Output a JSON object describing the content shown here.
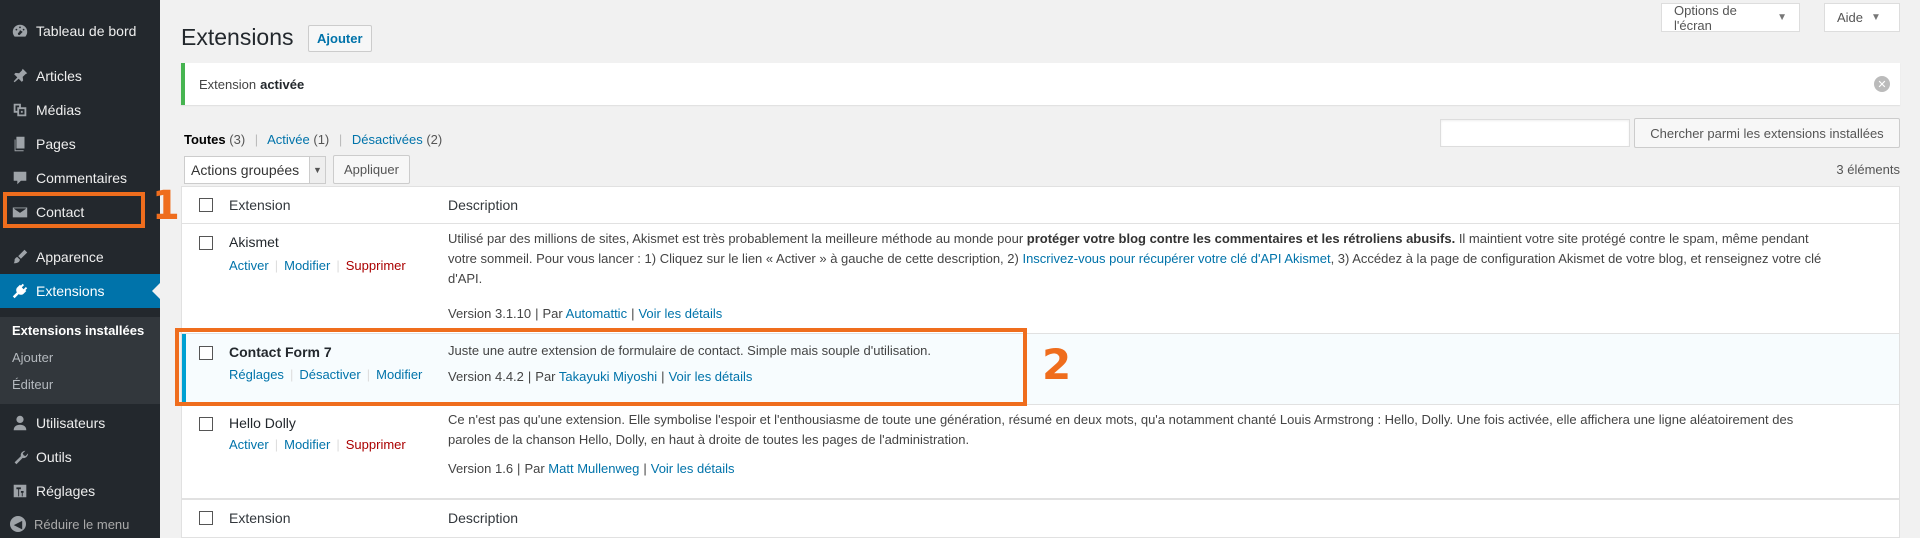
{
  "sidebar": {
    "items": [
      {
        "label": "Tableau de bord",
        "icon": "dashboard-icon"
      },
      {
        "label": "Articles",
        "icon": "pin-icon"
      },
      {
        "label": "Médias",
        "icon": "media-icon"
      },
      {
        "label": "Pages",
        "icon": "page-icon"
      },
      {
        "label": "Commentaires",
        "icon": "comment-icon"
      },
      {
        "label": "Contact",
        "icon": "envelope-icon"
      },
      {
        "label": "Apparence",
        "icon": "brush-icon"
      },
      {
        "label": "Extensions",
        "icon": "plugin-icon"
      },
      {
        "label": "Utilisateurs",
        "icon": "user-icon"
      },
      {
        "label": "Outils",
        "icon": "wrench-icon"
      },
      {
        "label": "Réglages",
        "icon": "sliders-icon"
      }
    ],
    "submenu": [
      "Extensions installées",
      "Ajouter",
      "Éditeur"
    ],
    "collapse_label": "Réduire le menu"
  },
  "annotations": {
    "one": "1",
    "two": "2"
  },
  "header": {
    "screen_options": "Options de l'écran",
    "help": "Aide",
    "title": "Extensions",
    "add_new": "Ajouter"
  },
  "notice": {
    "prefix": "Extension",
    "strong": "activée"
  },
  "filters": {
    "all": "Toutes",
    "all_count": "(3)",
    "active": "Activée",
    "active_count": "(1)",
    "inactive": "Désactivées",
    "inactive_count": "(2)"
  },
  "search": {
    "button": "Chercher parmi les extensions installées",
    "value": ""
  },
  "bulk": {
    "selected": "Actions groupées",
    "apply": "Appliquer"
  },
  "item_count": "3 éléments",
  "table": {
    "col_extension": "Extension",
    "col_description": "Description",
    "plugins": [
      {
        "name": "Akismet",
        "actions": [
          "Activer",
          "Modifier",
          "Supprimer"
        ],
        "desc_line1_a": "Utilisé par des millions de sites, Akismet est très probablement la meilleure méthode au monde pour ",
        "desc_line1_strong": "protéger votre blog contre les commentaires et les rétroliens abusifs.",
        "desc_line1_b": " Il maintient votre site protégé contre le spam, même pendant",
        "desc_line2_a": "votre sommeil. Pour vous lancer : 1) Cliquez sur le lien « Activer » à gauche de cette description, 2) ",
        "desc_line2_link": "Inscrivez-vous pour récupérer votre clé d'API Akismet",
        "desc_line2_b": ", 3) Accédez à la page de configuration Akismet de votre blog, et renseignez votre clé",
        "desc_line3": "d'API.",
        "version": "Version 3.1.10",
        "by": "Par",
        "author": "Automattic",
        "details": "Voir les détails"
      },
      {
        "name": "Contact Form 7",
        "actions": [
          "Réglages",
          "Désactiver",
          "Modifier"
        ],
        "desc": "Juste une autre extension de formulaire de contact. Simple mais souple d'utilisation.",
        "version": "Version 4.4.2",
        "by": "Par",
        "author": "Takayuki Miyoshi",
        "details": "Voir les détails"
      },
      {
        "name": "Hello Dolly",
        "actions": [
          "Activer",
          "Modifier",
          "Supprimer"
        ],
        "desc_line1": "Ce n'est pas qu'une extension. Elle symbolise l'espoir et l'enthousiasme de toute une génération, résumé en deux mots, qu'a notamment chanté Louis Armstrong : Hello, Dolly. Une fois activée, elle affichera une ligne aléatoirement des",
        "desc_line2": "paroles de la chanson Hello, Dolly, en haut à droite de toutes les pages de l'administration.",
        "version": "Version 1.6",
        "by": "Par",
        "author": "Matt Mullenweg",
        "details": "Voir les détails"
      }
    ]
  },
  "colors": {
    "accent": "#0073aa",
    "annotation": "#ef6d1d",
    "sidebar": "#23282d",
    "success": "#46b450"
  }
}
